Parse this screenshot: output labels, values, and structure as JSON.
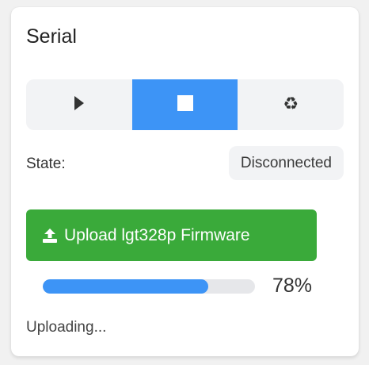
{
  "panel": {
    "title": "Serial"
  },
  "controls": {
    "items": [
      {
        "icon": "play-icon",
        "active": false
      },
      {
        "icon": "stop-icon",
        "active": true
      },
      {
        "icon": "recycle-icon",
        "active": false
      }
    ]
  },
  "state": {
    "label": "State:",
    "value": "Disconnected"
  },
  "upload": {
    "icon": "upload-icon",
    "label": "Upload lgt328p Firmware"
  },
  "progress": {
    "value": 0.78,
    "text": "78%"
  },
  "status": {
    "text": "Uploading..."
  },
  "colors": {
    "accent": "#3d94f6",
    "upload_button": "#3aaa3a",
    "segment_bg": "#f2f3f5"
  }
}
